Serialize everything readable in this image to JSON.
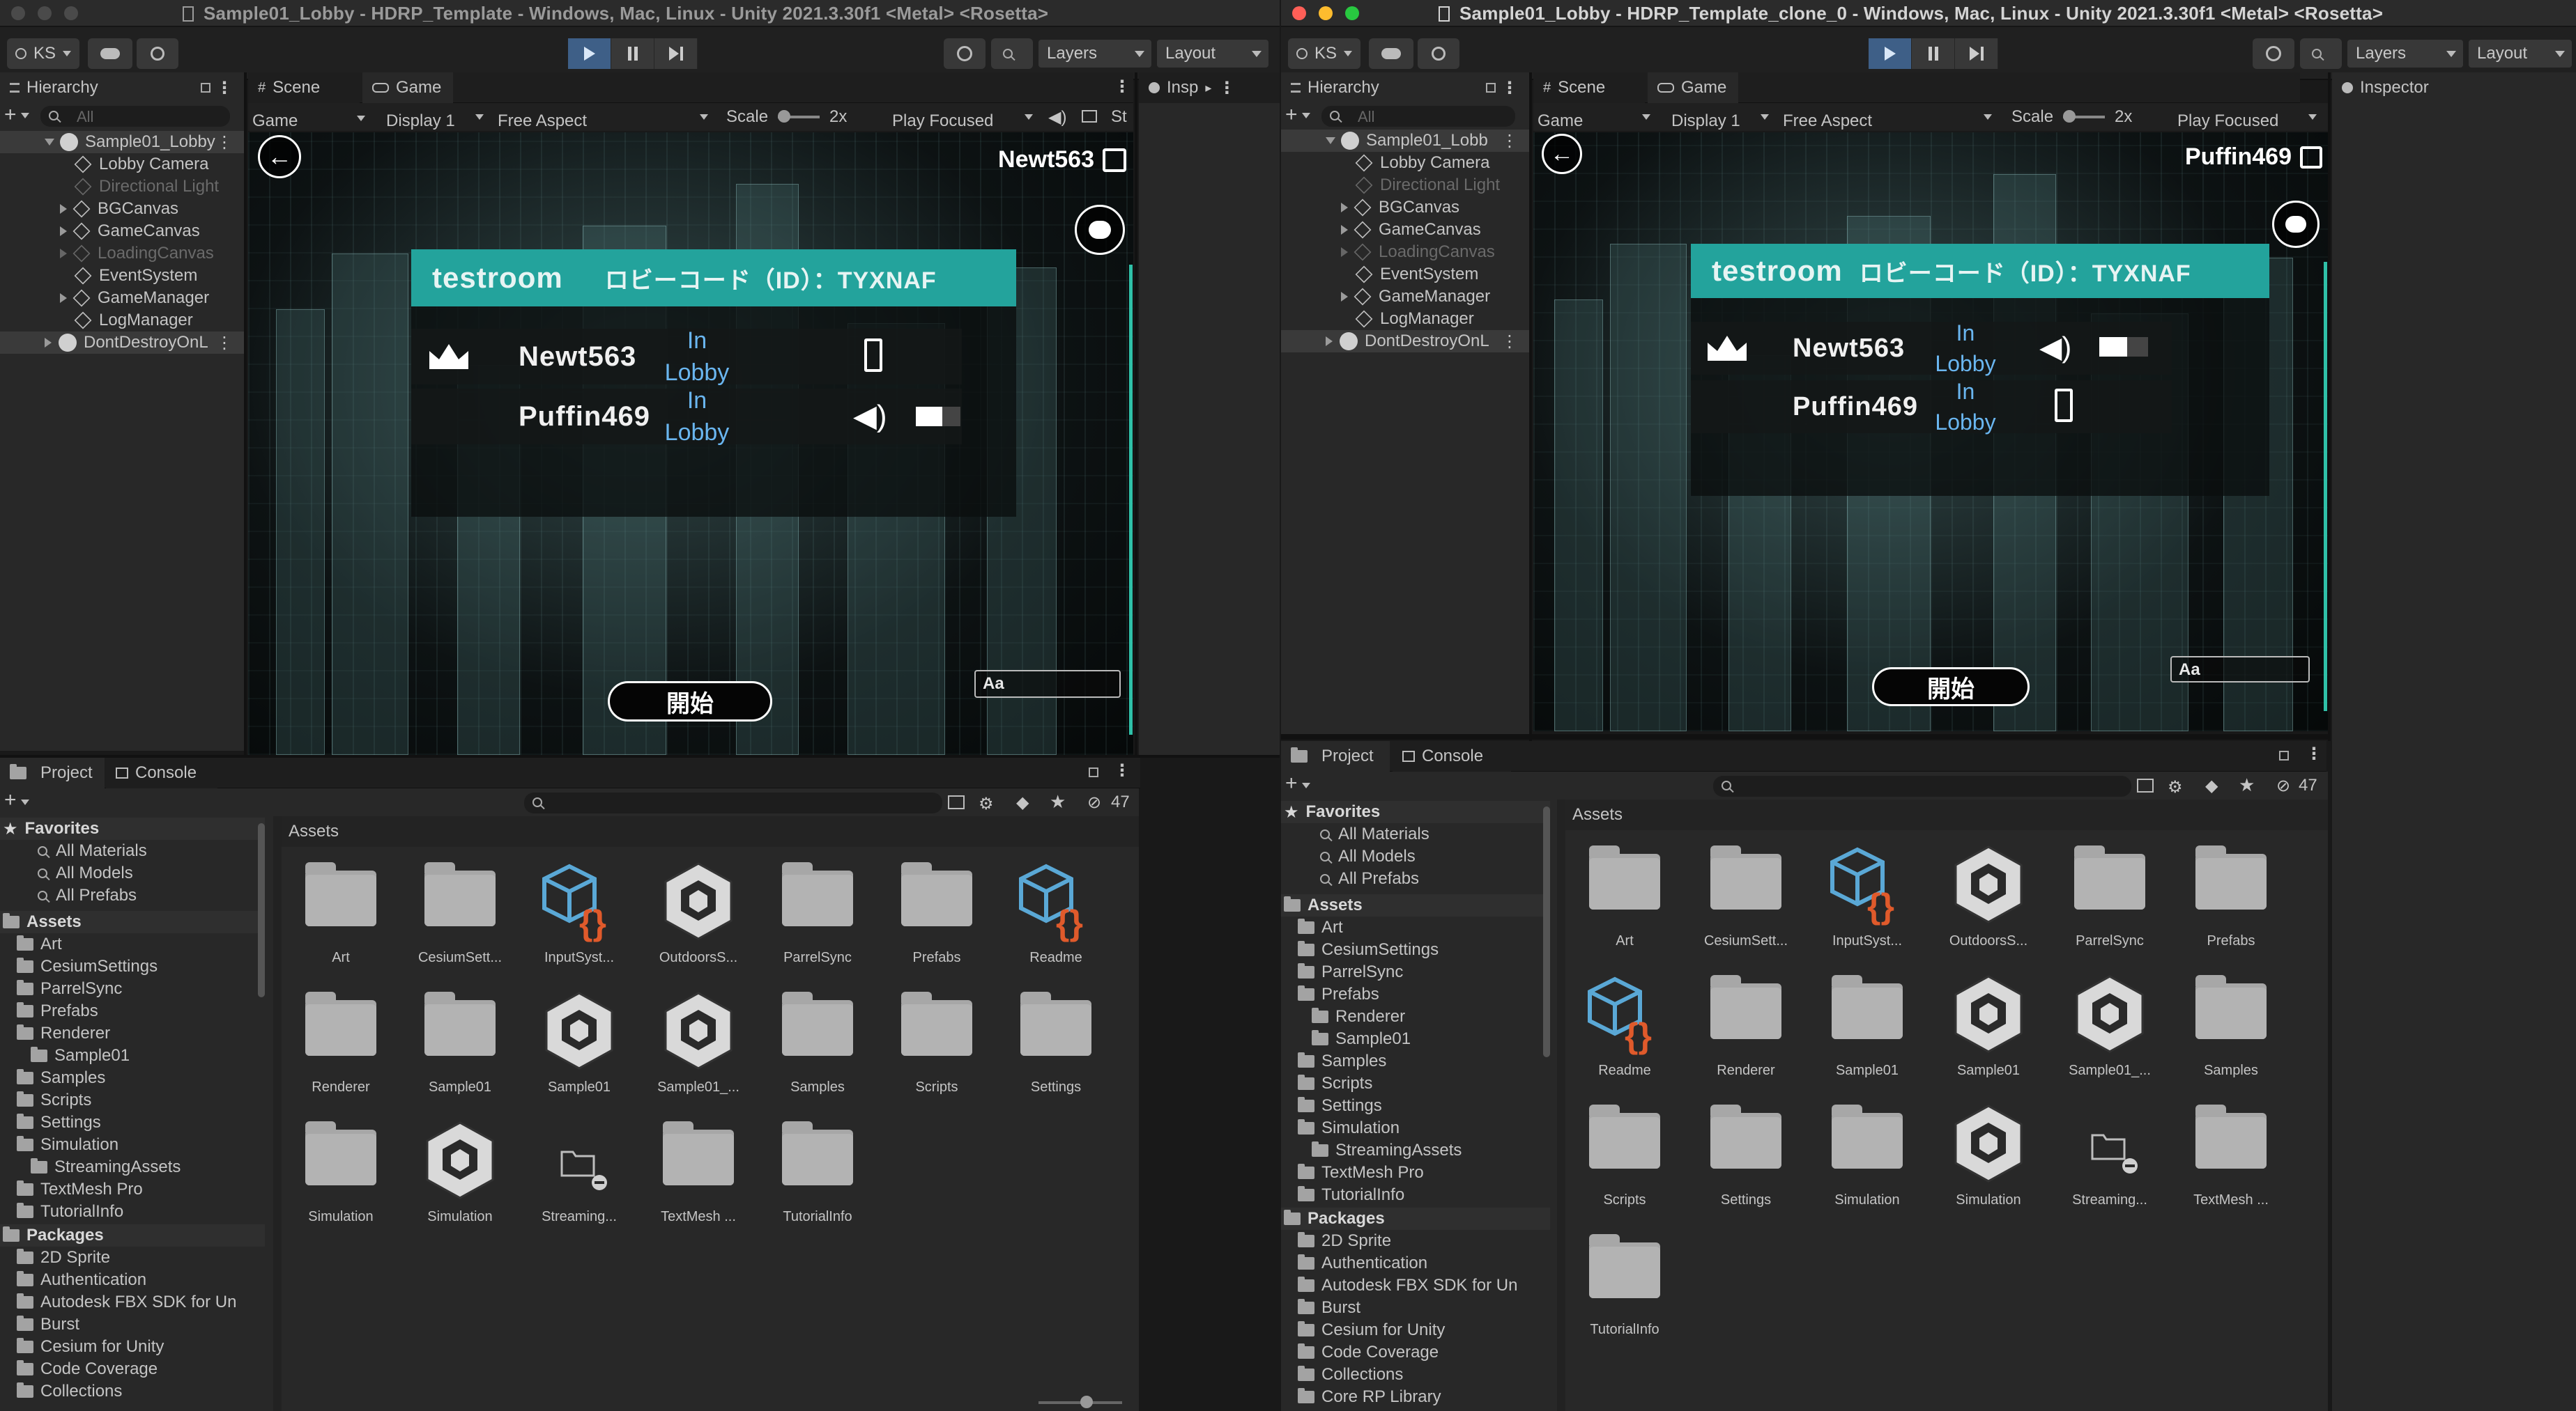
{
  "colors": {
    "teal": "#23a39c",
    "lobby_status": "#6ab6f0",
    "play_active": "#3e5f87",
    "close": "#fe5f57",
    "minimize": "#febc2e",
    "maximize": "#28c840"
  },
  "left": {
    "title": "Sample01_Lobby - HDRP_Template - Windows, Mac, Linux - Unity 2021.3.30f1 <Metal> <Rosetta>",
    "toolbar": {
      "account": "KS",
      "layers": "Layers",
      "layout": "Layout"
    },
    "tabs": {
      "hierarchy": "Hierarchy",
      "scene": "Scene",
      "game": "Game",
      "inspector": "Insp"
    },
    "search_placeholder": "All",
    "gamebar": {
      "game": "Game",
      "display": "Display 1",
      "aspect": "Free Aspect",
      "scale": "Scale",
      "scale_value": "2x",
      "play_focused": "Play Focused",
      "stats": "St"
    },
    "hierarchy": {
      "scene": "Sample01_Lobby",
      "items": [
        "Lobby Camera",
        "Directional Light",
        "BGCanvas",
        "GameCanvas",
        "LoadingCanvas",
        "EventSystem",
        "GameManager",
        "LogManager"
      ],
      "dontdestroy": "DontDestroyOnL"
    },
    "game": {
      "player_name": "Newt563",
      "room_name": "testroom",
      "lobby_code": "ロビーコード（ID）：TYXNAF",
      "players": [
        {
          "name": "Newt563",
          "status": "In\nLobby"
        },
        {
          "name": "Puffin469",
          "status": "In\nLobby"
        }
      ],
      "start_label": "開始",
      "chat_placeholder": "Aa"
    },
    "project": {
      "tabs": {
        "project": "Project",
        "console": "Console"
      },
      "hidden_count": "47",
      "favorites_header": "Favorites",
      "favorites": [
        "All Materials",
        "All Models",
        "All Prefabs"
      ],
      "assets_header": "Assets",
      "assets": [
        "Art",
        "CesiumSettings",
        "ParrelSync",
        "Prefabs",
        "Renderer",
        "Sample01",
        "Samples",
        "Scripts",
        "Settings",
        "Simulation",
        "StreamingAssets",
        "TextMesh Pro",
        "TutorialInfo"
      ],
      "packages_header": "Packages",
      "packages": [
        "2D Sprite",
        "Authentication",
        "Autodesk FBX SDK for Un",
        "Burst",
        "Cesium for Unity",
        "Code Coverage",
        "Collections"
      ],
      "grid_title": "Assets",
      "grid": [
        {
          "label": "Art",
          "type": "folder"
        },
        {
          "label": "CesiumSett...",
          "type": "folder"
        },
        {
          "label": "InputSyst...",
          "type": "script"
        },
        {
          "label": "OutdoorsS...",
          "type": "unity"
        },
        {
          "label": "ParrelSync",
          "type": "folder"
        },
        {
          "label": "Prefabs",
          "type": "folder"
        },
        {
          "label": "Readme",
          "type": "script"
        },
        {
          "label": "Renderer",
          "type": "folder"
        },
        {
          "label": "Sample01",
          "type": "folder"
        },
        {
          "label": "Sample01",
          "type": "unity"
        },
        {
          "label": "Sample01_...",
          "type": "unity"
        },
        {
          "label": "Samples",
          "type": "folder"
        },
        {
          "label": "Scripts",
          "type": "folder"
        },
        {
          "label": "Settings",
          "type": "folder"
        },
        {
          "label": "Simulation",
          "type": "folder"
        },
        {
          "label": "Simulation",
          "type": "unity"
        },
        {
          "label": "Streaming...",
          "type": "stream"
        },
        {
          "label": "TextMesh ...",
          "type": "folder"
        },
        {
          "label": "TutorialInfo",
          "type": "folder"
        }
      ]
    }
  },
  "right": {
    "title": "Sample01_Lobby - HDRP_Template_clone_0 - Windows, Mac, Linux - Unity 2021.3.30f1 <Metal> <Rosetta>",
    "toolbar": {
      "account": "KS",
      "layers": "Layers",
      "layout": "Layout"
    },
    "tabs": {
      "hierarchy": "Hierarchy",
      "scene": "Scene",
      "game": "Game",
      "inspector": "Inspector"
    },
    "search_placeholder": "All",
    "gamebar": {
      "game": "Game",
      "display": "Display 1",
      "aspect": "Free Aspect",
      "scale": "Scale",
      "scale_value": "2x",
      "play_focused": "Play Focused"
    },
    "hierarchy": {
      "scene": "Sample01_Lobb",
      "items": [
        "Lobby Camera",
        "Directional Light",
        "BGCanvas",
        "GameCanvas",
        "LoadingCanvas",
        "EventSystem",
        "GameManager",
        "LogManager"
      ],
      "dontdestroy": "DontDestroyOnL"
    },
    "game": {
      "player_name": "Puffin469",
      "room_name": "testroom",
      "lobby_code": "ロビーコード（ID）：TYXNAF",
      "players": [
        {
          "name": "Newt563",
          "status": "In\nLobby"
        },
        {
          "name": "Puffin469",
          "status": "In\nLobby"
        }
      ],
      "start_label": "開始",
      "chat_placeholder": "Aa"
    },
    "project": {
      "tabs": {
        "project": "Project",
        "console": "Console"
      },
      "hidden_count": "47",
      "favorites_header": "Favorites",
      "favorites": [
        "All Materials",
        "All Models",
        "All Prefabs"
      ],
      "assets_header": "Assets",
      "assets": [
        "Art",
        "CesiumSettings",
        "ParrelSync",
        "Prefabs",
        "Renderer",
        "Sample01",
        "Samples",
        "Scripts",
        "Settings",
        "Simulation",
        "StreamingAssets",
        "TextMesh Pro",
        "TutorialInfo"
      ],
      "packages_header": "Packages",
      "packages": [
        "2D Sprite",
        "Authentication",
        "Autodesk FBX SDK for Un",
        "Burst",
        "Cesium for Unity",
        "Code Coverage",
        "Collections",
        "Core RP Library"
      ],
      "grid_title": "Assets",
      "grid": [
        {
          "label": "Art",
          "type": "folder"
        },
        {
          "label": "CesiumSett...",
          "type": "folder"
        },
        {
          "label": "InputSyst...",
          "type": "script"
        },
        {
          "label": "OutdoorsS...",
          "type": "unity"
        },
        {
          "label": "ParrelSync",
          "type": "folder"
        },
        {
          "label": "Prefabs",
          "type": "folder"
        },
        {
          "label": "Readme",
          "type": "script"
        },
        {
          "label": "Renderer",
          "type": "folder"
        },
        {
          "label": "Sample01",
          "type": "folder"
        },
        {
          "label": "Sample01",
          "type": "unity"
        },
        {
          "label": "Sample01_...",
          "type": "unity"
        },
        {
          "label": "Samples",
          "type": "folder"
        },
        {
          "label": "Scripts",
          "type": "folder"
        },
        {
          "label": "Settings",
          "type": "folder"
        },
        {
          "label": "Simulation",
          "type": "folder"
        },
        {
          "label": "Simulation",
          "type": "unity"
        },
        {
          "label": "Streaming...",
          "type": "stream"
        },
        {
          "label": "TextMesh ...",
          "type": "folder"
        },
        {
          "label": "TutorialInfo",
          "type": "folder"
        }
      ]
    }
  }
}
